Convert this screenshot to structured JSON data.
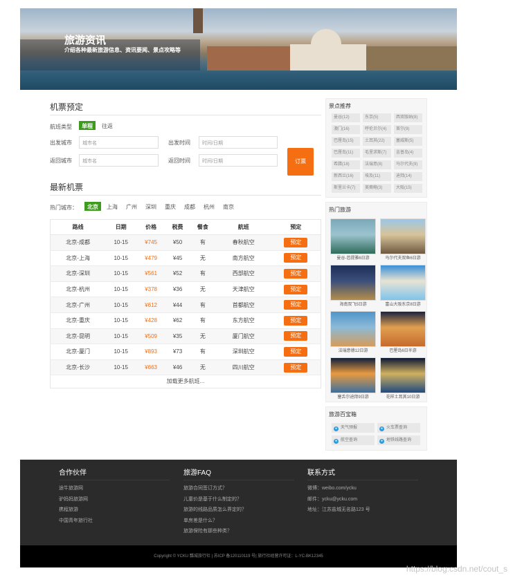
{
  "banner": {
    "title": "旅游资讯",
    "subtitle": "介绍各种最新旅游信息、资讯要闻、景点攻略等"
  },
  "booking": {
    "title": "机票预定",
    "type_label": "航班类型",
    "type_options": [
      "单程",
      "往返"
    ],
    "depart_city_label": "出发城市",
    "depart_city_placeholder": "城市名",
    "depart_time_label": "出发时间",
    "depart_time_placeholder": "时间/日期",
    "return_city_label": "返回城市",
    "return_city_placeholder": "城市名",
    "return_time_label": "返回时间",
    "return_time_placeholder": "时间/日期",
    "submit_label": "订票"
  },
  "latest": {
    "title": "最新机票",
    "hot_label": "热门城市：",
    "cities": [
      "北京",
      "上海",
      "广州",
      "深圳",
      "重庆",
      "成都",
      "杭州",
      "南京"
    ],
    "columns": [
      "路线",
      "日期",
      "价格",
      "税费",
      "餐食",
      "航班",
      "预定"
    ],
    "rows": [
      {
        "route": "北京-成都",
        "date": "10-15",
        "price": "¥745",
        "tax": "¥50",
        "meal": "有",
        "airline": "春秋航空",
        "action": "预定"
      },
      {
        "route": "北京-上海",
        "date": "10-15",
        "price": "¥479",
        "tax": "¥45",
        "meal": "无",
        "airline": "南方航空",
        "action": "预定"
      },
      {
        "route": "北京-深圳",
        "date": "10-15",
        "price": "¥561",
        "tax": "¥52",
        "meal": "有",
        "airline": "西部航空",
        "action": "预定"
      },
      {
        "route": "北京-杭州",
        "date": "10-15",
        "price": "¥378",
        "tax": "¥36",
        "meal": "无",
        "airline": "天津航空",
        "action": "预定"
      },
      {
        "route": "北京-广州",
        "date": "10-15",
        "price": "¥612",
        "tax": "¥44",
        "meal": "有",
        "airline": "首都航空",
        "action": "预定"
      },
      {
        "route": "北京-重庆",
        "date": "10-15",
        "price": "¥428",
        "tax": "¥62",
        "meal": "有",
        "airline": "东方航空",
        "action": "预定"
      },
      {
        "route": "北京-昆明",
        "date": "10-15",
        "price": "¥509",
        "tax": "¥35",
        "meal": "无",
        "airline": "厦门航空",
        "action": "预定"
      },
      {
        "route": "北京-厦门",
        "date": "10-15",
        "price": "¥893",
        "tax": "¥73",
        "meal": "有",
        "airline": "深圳航空",
        "action": "预定"
      },
      {
        "route": "北京-长沙",
        "date": "10-15",
        "price": "¥663",
        "tax": "¥46",
        "meal": "无",
        "airline": "四川航空",
        "action": "预定"
      }
    ],
    "load_more": "加载更多航班..."
  },
  "sidebar": {
    "spots_title": "景点推荐",
    "spots": [
      "曼谷(12)",
      "东京(5)",
      "西双版纳(8)",
      "澳门(16)",
      "呼伦贝尔(4)",
      "首尔(9)",
      "巴厘岛(15)",
      "土耳其(22)",
      "塞威斯(5)",
      "巴厘岛(11)",
      "毛里求斯(7)",
      "吉普岛(4)",
      "希腊(18)",
      "法瑞意(8)",
      "马尔代夫(9)",
      "新西兰(16)",
      "埃及(11)",
      "迪拜(14)",
      "斯里兰卡(7)",
      "美裔鲍(3)",
      "大阪(15)"
    ],
    "tours_title": "热门旅游",
    "tours": [
      {
        "caption": "曼谷-芭提雅6日游",
        "colors": [
          "#7aa8b8",
          "#2f6b5a",
          "#9cc3cf"
        ]
      },
      {
        "caption": "马尔代夫双鱼6日游",
        "colors": [
          "#9cc7e6",
          "#6e5940",
          "#d8c49a"
        ]
      },
      {
        "caption": "海南双飞5日游",
        "colors": [
          "#1d2f57",
          "#b58e4a",
          "#3a4f7a"
        ]
      },
      {
        "caption": "富山大阪东京8日游",
        "colors": [
          "#3a8fd6",
          "#7ec4ea",
          "#e8e3d3"
        ]
      },
      {
        "caption": "法瑞意德12日游",
        "colors": [
          "#4f95c8",
          "#d59b59",
          "#8cbad8"
        ]
      },
      {
        "caption": "巴厘岛6日半游",
        "colors": [
          "#1b2140",
          "#c66a2e",
          "#e0a050"
        ]
      },
      {
        "caption": "塞舌尔迪拜9日游",
        "colors": [
          "#0f1f3a",
          "#3a6fa0",
          "#e89a40"
        ]
      },
      {
        "caption": "花样土耳其10日游",
        "colors": [
          "#0b1834",
          "#1f4a80",
          "#d0b060"
        ]
      }
    ],
    "tools_title": "旅游百宝箱",
    "tools": [
      "天气预报",
      "火车票查询",
      "航空查询",
      "地铁线路查询"
    ]
  },
  "footer": {
    "partners_title": "合作伙伴",
    "partners": [
      "途牛旅游网",
      "驴妈妈旅游网",
      "携程旅游",
      "中国青年旅行社"
    ],
    "faq_title": "旅游FAQ",
    "faq": [
      "旅游合同签订方式？",
      "儿童价是基于什么制定的？",
      "旅游的线路品质怎么界定的？",
      "单房差是什么？",
      "旅游保险有那些种类？"
    ],
    "contact_title": "联系方式",
    "contact": [
      "微博：weibo.com/ycku",
      "邮件：ycku@ycku.com",
      "地址：江苏盐城无名路123 号"
    ],
    "copyright": "Copyright © YCKU 瓢城旅行社 | 苏ICP 备120110119 号| 旅行社经营许可证：L-YC-BK12345"
  },
  "watermark": "https://blog.csdn.net/cout_s"
}
